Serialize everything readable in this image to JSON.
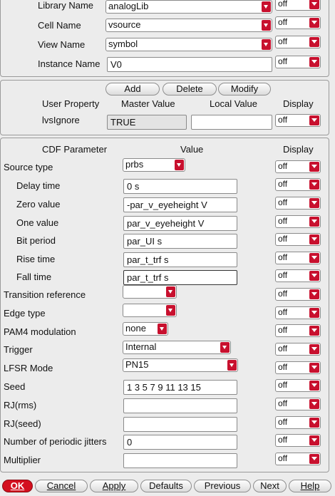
{
  "library": {
    "labels": [
      "Library Name",
      "Cell Name",
      "View Name",
      "Instance Name"
    ],
    "values": [
      "analogLib",
      "vsource",
      "symbol",
      "V0"
    ],
    "display": [
      "off",
      "off",
      "off",
      "off"
    ]
  },
  "property": {
    "buttons": [
      "Add",
      "Delete",
      "Modify"
    ],
    "headers": [
      "User Property",
      "Master Value",
      "Local Value",
      "Display"
    ],
    "name": "lvsIgnore",
    "master_value": "TRUE",
    "local_value": "",
    "display": "off"
  },
  "cdf": {
    "headers": [
      "CDF Parameter",
      "Value",
      "Display"
    ],
    "rows": [
      {
        "label": "Source type",
        "value": "prbs",
        "display": "off"
      },
      {
        "label": "Delay time",
        "value": "0 s",
        "display": "off"
      },
      {
        "label": "Zero value",
        "value": "-par_v_eyeheight V",
        "display": "off"
      },
      {
        "label": "One value",
        "value": "par_v_eyeheight V",
        "display": "off"
      },
      {
        "label": "Bit period",
        "value": "par_UI s",
        "display": "off"
      },
      {
        "label": "Rise time",
        "value": "par_t_trf s",
        "display": "off"
      },
      {
        "label": "Fall time",
        "value": "par_t_trf s",
        "display": "off"
      },
      {
        "label": "Transition reference",
        "value": "",
        "display": "off"
      },
      {
        "label": "Edge type",
        "value": "",
        "display": "off"
      },
      {
        "label": "PAM4 modulation",
        "value": "none",
        "display": "off"
      },
      {
        "label": "Trigger",
        "value": "Internal",
        "display": "off"
      },
      {
        "label": "LFSR Mode",
        "value": "PN15",
        "display": "off"
      },
      {
        "label": "Seed",
        "value": "1 3 5 7 9 11 13 15",
        "display": "off"
      },
      {
        "label": "RJ(rms)",
        "value": "",
        "display": "off"
      },
      {
        "label": "RJ(seed)",
        "value": "",
        "display": "off"
      },
      {
        "label": "Number of periodic jitters",
        "value": "0",
        "display": "off"
      },
      {
        "label": "Multiplier",
        "value": "",
        "display": "off"
      }
    ]
  },
  "footer": {
    "ok": "OK",
    "cancel": "Cancel",
    "apply": "Apply",
    "defaults": "Defaults",
    "previous": "Previous",
    "next": "Next",
    "help": "Help"
  },
  "colors": {
    "accent": "#c8102e",
    "panel": "#ececec"
  }
}
